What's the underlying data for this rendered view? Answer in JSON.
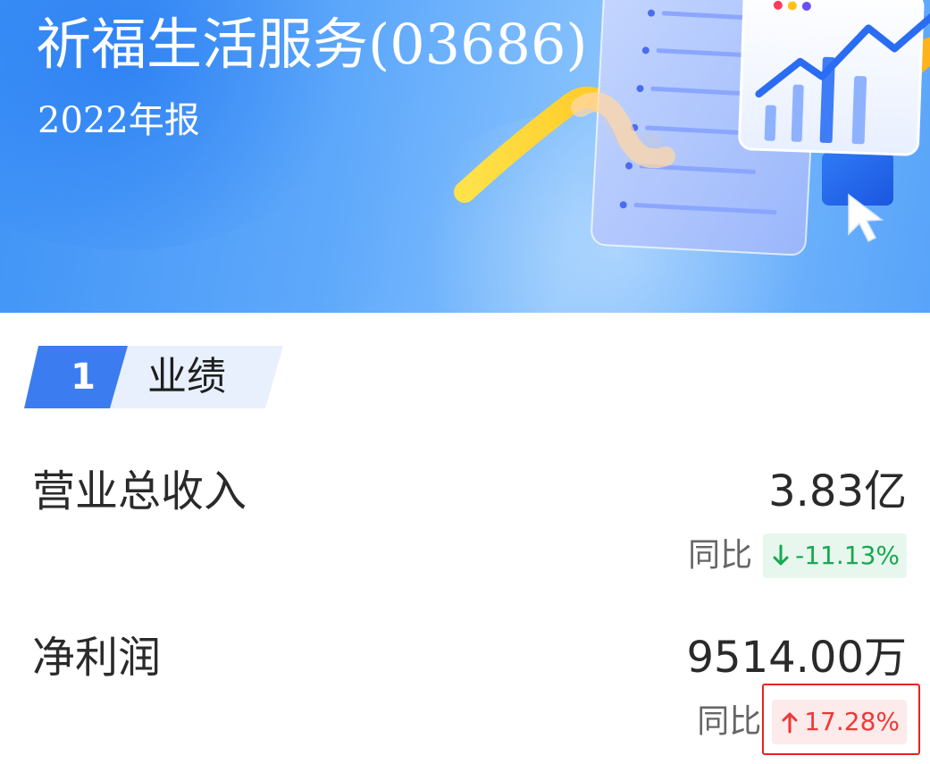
{
  "header": {
    "title": "祈福生活服务(03686)",
    "subtitle": "2022年报"
  },
  "section": {
    "number": "1",
    "title": "业绩"
  },
  "metrics": [
    {
      "label": "营业总收入",
      "value": "3.83亿",
      "yoy_label": "同比",
      "yoy_change": "-11.13%",
      "direction": "down",
      "color": "#16a950"
    },
    {
      "label": "净利润",
      "value": "9514.00万",
      "yoy_label": "同比",
      "yoy_change": "17.28%",
      "direction": "up",
      "color": "#f03737"
    }
  ],
  "icons": [
    "report-illustration-icon",
    "arrow-down-icon",
    "arrow-up-icon",
    "cursor-icon"
  ],
  "colors": {
    "hero_blue": "#4a9cf7",
    "section_blue": "#3b7df0",
    "section_tint": "#e8f0fd",
    "decrease_green": "#16a950",
    "increase_red": "#f03737",
    "highlight_red": "#e82222"
  }
}
